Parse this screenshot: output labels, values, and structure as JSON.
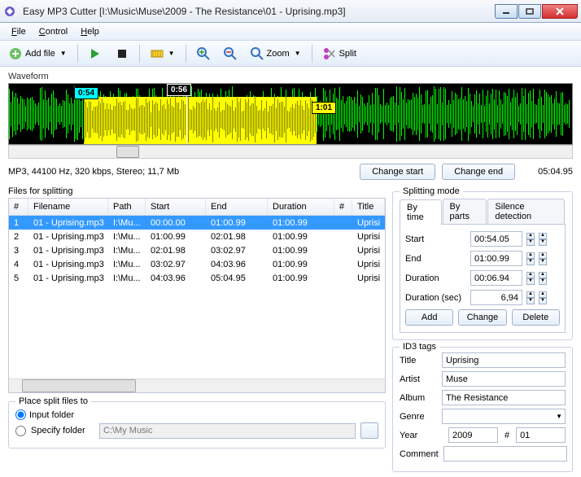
{
  "window": {
    "title": "Easy MP3 Cutter [I:\\Music\\Muse\\2009 - The Resistance\\01 - Uprising.mp3]"
  },
  "menu": {
    "file": "File",
    "control": "Control",
    "help": "Help"
  },
  "toolbar": {
    "add_file": "Add file",
    "zoom": "Zoom",
    "split": "Split"
  },
  "waveform": {
    "label": "Waveform",
    "marker_start": "0:54",
    "marker_center": "0:56",
    "marker_end": "1:01"
  },
  "info": {
    "text": "MP3, 44100 Hz, 320 kbps, Stereo; 11,7 Mb",
    "change_start": "Change start",
    "change_end": "Change end",
    "total": "05:04.95"
  },
  "table": {
    "label": "Files for splitting",
    "headers": {
      "n": "#",
      "fn": "Filename",
      "path": "Path",
      "start": "Start",
      "end": "End",
      "dur": "Duration",
      "x": "#",
      "title": "Title"
    },
    "rows": [
      {
        "n": "1",
        "fn": "01 - Uprising.mp3",
        "path": "I:\\Mu...",
        "start": "00:00.00",
        "end": "01:00.99",
        "dur": "01:00.99",
        "title": "Uprisi"
      },
      {
        "n": "2",
        "fn": "01 - Uprising.mp3",
        "path": "I:\\Mu...",
        "start": "01:00.99",
        "end": "02:01.98",
        "dur": "01:00.99",
        "title": "Uprisi"
      },
      {
        "n": "3",
        "fn": "01 - Uprising.mp3",
        "path": "I:\\Mu...",
        "start": "02:01.98",
        "end": "03:02.97",
        "dur": "01:00.99",
        "title": "Uprisi"
      },
      {
        "n": "4",
        "fn": "01 - Uprising.mp3",
        "path": "I:\\Mu...",
        "start": "03:02.97",
        "end": "04:03.96",
        "dur": "01:00.99",
        "title": "Uprisi"
      },
      {
        "n": "5",
        "fn": "01 - Uprising.mp3",
        "path": "I:\\Mu...",
        "start": "04:03.96",
        "end": "05:04.95",
        "dur": "01:00.99",
        "title": "Uprisi"
      }
    ]
  },
  "dest": {
    "label": "Place split files to",
    "input_folder": "Input folder",
    "specify_folder": "Specify folder",
    "path": "C:\\My Music"
  },
  "mode": {
    "label": "Splitting mode",
    "tabs": {
      "bytime": "By time",
      "byparts": "By parts",
      "silence": "Silence detection"
    },
    "start_label": "Start",
    "start": "00:54.05",
    "end_label": "End",
    "end": "01:00.99",
    "dur_label": "Duration",
    "dur": "00:06.94",
    "dursec_label": "Duration (sec)",
    "dursec": "6,94",
    "add": "Add",
    "change": "Change",
    "delete": "Delete"
  },
  "id3": {
    "label": "ID3 tags",
    "title_label": "Title",
    "title": "Uprising",
    "artist_label": "Artist",
    "artist": "Muse",
    "album_label": "Album",
    "album": "The Resistance",
    "genre_label": "Genre",
    "genre": "",
    "year_label": "Year",
    "year": "2009",
    "track_hash": "#",
    "track": "01",
    "comment_label": "Comment",
    "comment": ""
  }
}
